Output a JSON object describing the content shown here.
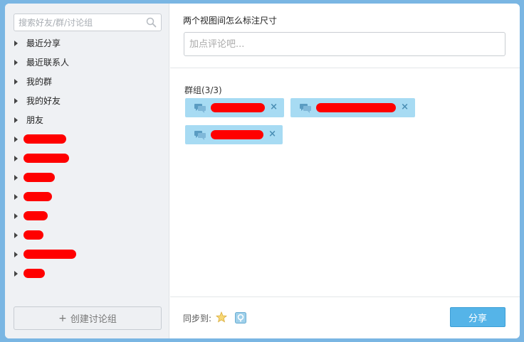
{
  "sidebar": {
    "search_placeholder": "搜索好友/群/讨论组",
    "items": [
      {
        "label": "最近分享"
      },
      {
        "label": "最近联系人"
      },
      {
        "label": "我的群"
      },
      {
        "label": "我的好友"
      },
      {
        "label": "朋友"
      }
    ],
    "redacted_count": 8,
    "create_label": "创建讨论组",
    "create_prefix": "+"
  },
  "main": {
    "title": "两个视图间怎么标注尺寸",
    "comment_placeholder": "加点评论吧...",
    "group_label": "群组(3/3)",
    "chip_remove": "×",
    "sync_label": "同步到:",
    "share_label": "分享"
  },
  "colors": {
    "accent": "#55b4e8",
    "chip": "#a7dbf3",
    "redaction": "#ff0000",
    "sidebar_bg": "#eff1f4"
  },
  "icons": [
    "search-icon",
    "triangle-right-icon",
    "chat-bubble-icon",
    "close-icon",
    "star-icon",
    "weibo-icon"
  ]
}
